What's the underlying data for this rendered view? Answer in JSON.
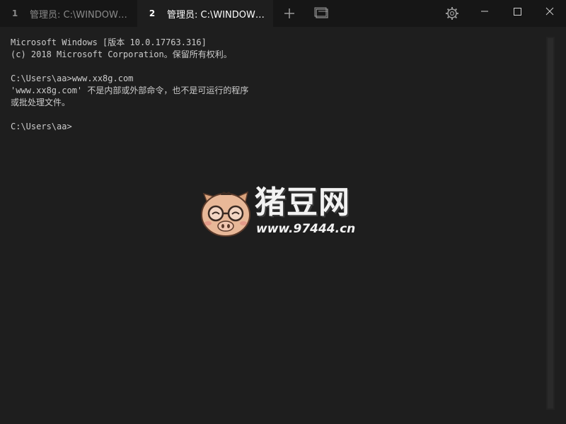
{
  "tabs": [
    {
      "index": "1",
      "title": "管理员: C:\\WINDOWS..."
    },
    {
      "index": "2",
      "title": "管理员: C:\\WINDOWS..."
    }
  ],
  "icons": {
    "new_tab": "plus-icon",
    "dropdown": "tab-dropdown-icon",
    "settings": "gear-icon",
    "minimize": "minimize-icon",
    "maximize": "maximize-icon",
    "close": "close-icon"
  },
  "terminal": {
    "lines": [
      "Microsoft Windows [版本 10.0.17763.316]",
      "(c) 2018 Microsoft Corporation。保留所有权利。",
      "",
      "C:\\Users\\aa>www.xx8g.com",
      "'www.xx8g.com' 不是内部或外部命令，也不是可运行的程序",
      "或批处理文件。",
      "",
      "C:\\Users\\aa>"
    ]
  },
  "watermark": {
    "title": "猪豆网",
    "url": "www.97444.cn"
  },
  "colors": {
    "background": "#1e1e1e",
    "titlebar": "#161616",
    "text": "#cccccc"
  }
}
